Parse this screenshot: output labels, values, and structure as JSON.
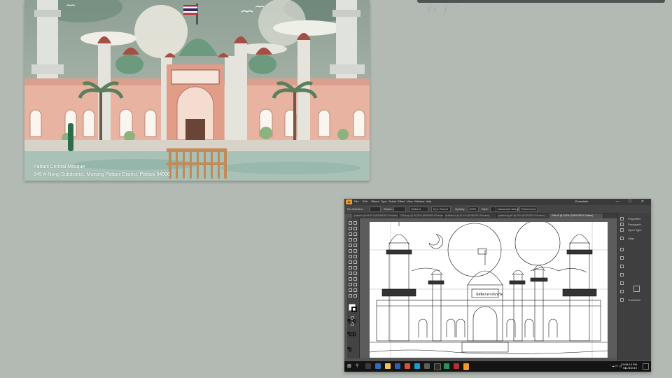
{
  "poster": {
    "caption_line1": "Pattani Central Mosque",
    "caption_line2": "249 A-Nong Subdistrict, Mueang Pattani District, Pattani 94000",
    "sign_text": "มัสยิดกลางจังหวัดปัตตานี"
  },
  "illustrator": {
    "app_icon": "Ai",
    "menu": [
      "File",
      "Edit",
      "Object",
      "Type",
      "Select",
      "Effect",
      "View",
      "Window",
      "Help"
    ],
    "workspace": "Essentials",
    "window_buttons": "— ☐ ✕",
    "control_bar": {
      "selection": "No Selection",
      "stroke_label": "Stroke:",
      "stroke_value": "1 pt",
      "brush_label": "Uniform",
      "profile_label": "5 pt. Round",
      "opacity_label": "Opacity:",
      "opacity_value": "100%",
      "style_label": "Style:",
      "doc_setup": "Document Setup",
      "preferences": "Preferences"
    },
    "tabs": [
      "pattani* @ 66.67% (RGB/GPU Preview)",
      "118.svg* @ 54.24% (RGB/GPU Preview)",
      "Untitled-4 @ 41.1% (RGB/GPU Preview)",
      "pattani-bg.ai* @ 25% (RGB/GPU Preview)",
      "249.ai* @ 100% (CMYK/GPU Outline)"
    ],
    "panel_items": [
      "Properties",
      "Paragraph",
      "Open Type",
      "Align",
      "Transform"
    ],
    "artboard_sign": "มัสยิดกลางจังหวัด",
    "side_text": [
      "ขจ",
      "ขย",
      "ข"
    ]
  },
  "taskbar": {
    "start_icon": "windows-logo",
    "search_icon": "search-icon",
    "language": "ENG",
    "language_sub": "IN",
    "time": "8:15 PM",
    "date": "11/5/2019"
  },
  "colors": {
    "background": "#b3bab3",
    "poster_sky": "#9aa79f",
    "mosque_wall": "#e8b3a1",
    "dome_green": "#6d9a7e",
    "dome_red": "#a54e45",
    "illustrator_chrome": "#535353",
    "taskbar": "#141414"
  }
}
